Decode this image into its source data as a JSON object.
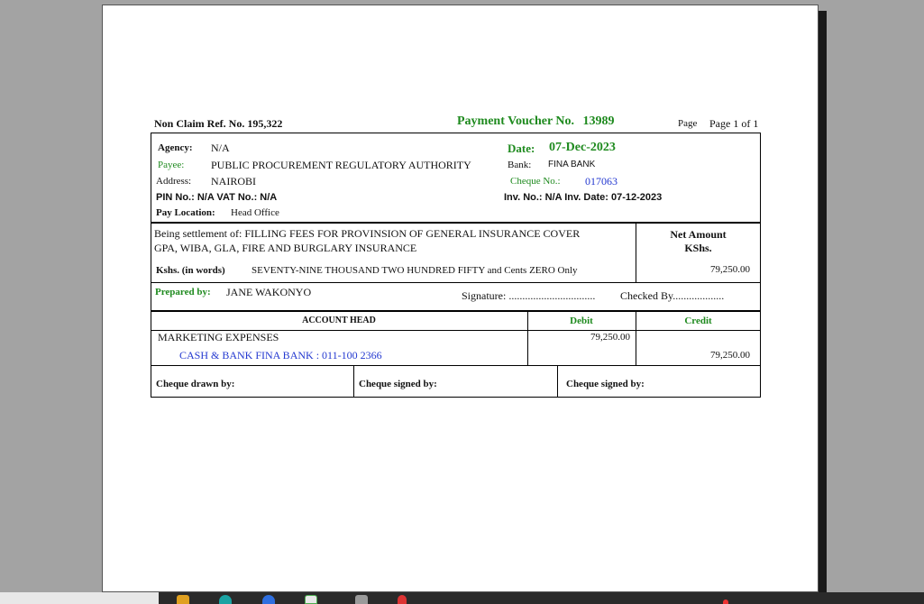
{
  "header": {
    "non_claim_ref": "Non Claim Ref. No. 195,322",
    "voucher_title": "Payment Voucher No.",
    "voucher_no": "13989",
    "page_label": "Page",
    "page_value": "Page 1 of 1"
  },
  "details": {
    "agency_label": "Agency:",
    "agency_value": "N/A",
    "payee_label": "Payee:",
    "payee_value": "PUBLIC PROCUREMENT REGULATORY AUTHORITY",
    "address_label": "Address:",
    "address_value": "NAIROBI",
    "pin_vat": "PIN No.: N/A  VAT No.: N/A",
    "pay_location_label": "Pay Location:",
    "pay_location_value": "Head Office",
    "date_label": "Date:",
    "date_value": "07-Dec-2023",
    "bank_label": "Bank:",
    "bank_value": "FINA BANK",
    "cheque_no_label": "Cheque No.:",
    "cheque_no_value": "017063",
    "inv": "Inv. No.: N/A  Inv. Date: 07-12-2023"
  },
  "settlement": {
    "prefix": "Being settlement of:",
    "line1": "FILLING FEES FOR PROVINSION OF GENERAL INSURANCE COVER",
    "line2": "GPA, WIBA, GLA, FIRE AND BURGLARY INSURANCE",
    "words_label": "Kshs. (in words)",
    "words_value": "SEVENTY-NINE THOUSAND TWO HUNDRED FIFTY and Cents ZERO Only",
    "net_amount_label": "Net Amount",
    "net_currency_label": "KShs.",
    "net_amount_value": "79,250.00"
  },
  "prepared": {
    "label": "Prepared by:",
    "value": "JANE WAKONYO",
    "signature": "Signature: ................................",
    "checked": "Checked By..................."
  },
  "accounts": {
    "col_head": "ACCOUNT HEAD",
    "col_debit": "Debit",
    "col_credit": "Credit",
    "rows": [
      {
        "account": "MARKETING EXPENSES",
        "debit": "79,250.00",
        "credit": ""
      },
      {
        "account": "CASH & BANK FINA BANK : 011-100 2366",
        "debit": "",
        "credit": "79,250.00"
      }
    ]
  },
  "cheque": {
    "drawn_by": "Cheque drawn by:",
    "signed_by_1": "Cheque signed by:",
    "signed_by_2": "Cheque signed by:"
  },
  "colors": {
    "green": "#1e8a1e",
    "blue": "#2338d0",
    "background": "#a3a3a3"
  }
}
